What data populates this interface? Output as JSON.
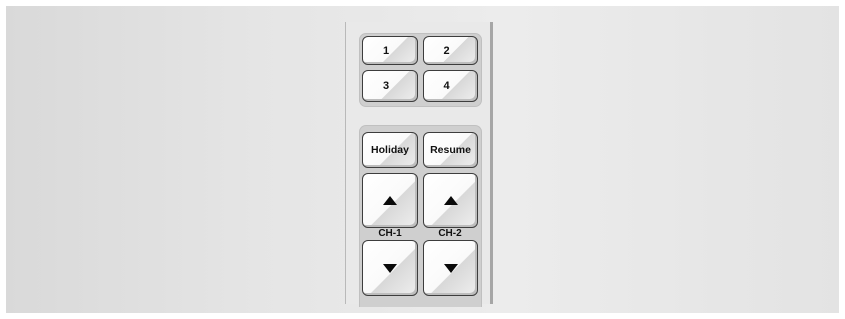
{
  "keypad": {
    "buttons": {
      "b1": "1",
      "b2": "2",
      "b3": "3",
      "b4": "4"
    },
    "holiday_label": "Holiday",
    "resume_label": "Resume",
    "channels": [
      {
        "label": "CH-1",
        "up_icon": "triangle-up",
        "down_icon": "triangle-down"
      },
      {
        "label": "CH-2",
        "up_icon": "triangle-up",
        "down_icon": "triangle-down"
      }
    ]
  }
}
